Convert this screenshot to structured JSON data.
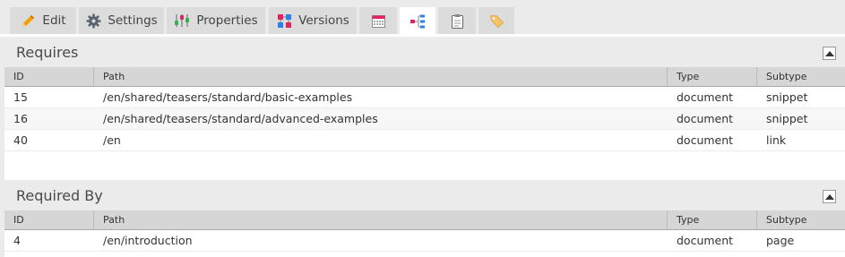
{
  "tabs": [
    {
      "label": "Edit",
      "icon": "pencil-icon"
    },
    {
      "label": "Settings",
      "icon": "gear-icon"
    },
    {
      "label": "Properties",
      "icon": "properties-icon"
    },
    {
      "label": "Versions",
      "icon": "versions-icon"
    },
    {
      "label": "",
      "icon": "calendar-icon"
    },
    {
      "label": "",
      "icon": "dependencies-icon",
      "active": true
    },
    {
      "label": "",
      "icon": "clipboard-icon"
    },
    {
      "label": "",
      "icon": "tag-icon"
    }
  ],
  "requires": {
    "title": "Requires",
    "columns": {
      "id": "ID",
      "path": "Path",
      "type": "Type",
      "subtype": "Subtype"
    },
    "rows": [
      {
        "id": "15",
        "path": "/en/shared/teasers/standard/basic-examples",
        "type": "document",
        "subtype": "snippet"
      },
      {
        "id": "16",
        "path": "/en/shared/teasers/standard/advanced-examples",
        "type": "document",
        "subtype": "snippet"
      },
      {
        "id": "40",
        "path": "/en",
        "type": "document",
        "subtype": "link"
      }
    ]
  },
  "required_by": {
    "title": "Required By",
    "columns": {
      "id": "ID",
      "path": "Path",
      "type": "Type",
      "subtype": "Subtype"
    },
    "rows": [
      {
        "id": "4",
        "path": "/en/introduction",
        "type": "document",
        "subtype": "page"
      }
    ]
  },
  "colors": {
    "tab_bg": "#dcdcdc",
    "tab_active_bg": "#ffffff",
    "panel_bg": "#ebebeb",
    "grid_header_bg": "#d6d6d6",
    "pencil": "#f0a000",
    "gear": "#5a6470",
    "versions": "#e0245e",
    "accent_blue": "#2f80ed",
    "tag": "#f5c36b"
  }
}
